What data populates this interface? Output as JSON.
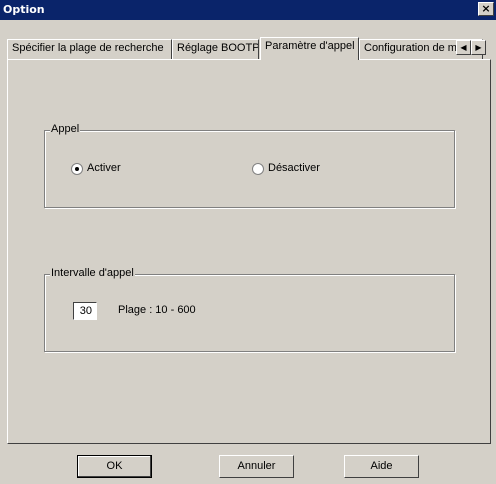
{
  "window": {
    "title": "Option",
    "close_glyph": "×"
  },
  "tabs": [
    {
      "label": "Spécifier la plage de recherche",
      "active": false
    },
    {
      "label": "Réglage BOOTP",
      "active": false
    },
    {
      "label": "Paramètre d'appel",
      "active": true
    },
    {
      "label": "Configuration de mot de passe",
      "active": false
    }
  ],
  "tab_scroll": {
    "left_glyph": "◀",
    "right_glyph": "▶"
  },
  "appel_group": {
    "label": "Appel",
    "options": [
      {
        "label": "Activer",
        "selected": true
      },
      {
        "label": "Désactiver",
        "selected": false
      }
    ]
  },
  "interval_group": {
    "label": "Intervalle d'appel",
    "value": "30",
    "range_label": "Plage : 10 - 600"
  },
  "buttons": {
    "ok": "OK",
    "cancel": "Annuler",
    "help": "Aide"
  }
}
